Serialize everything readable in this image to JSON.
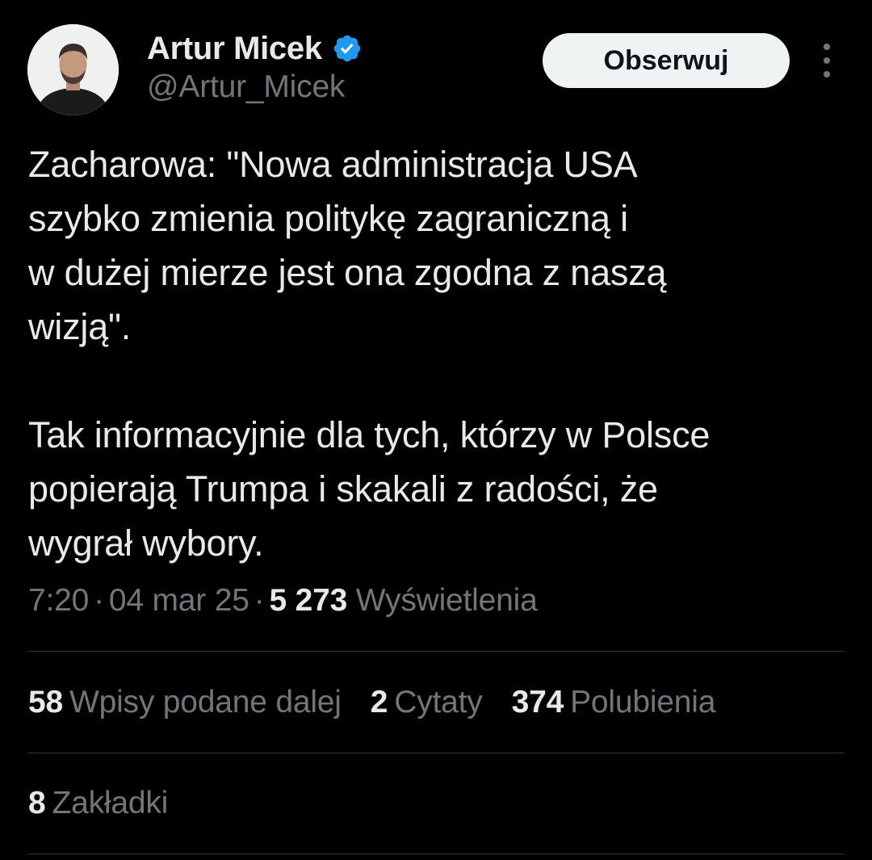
{
  "author": {
    "name": "Artur Micek",
    "handle": "@Artur_Micek",
    "verified_icon": "verified-badge-icon",
    "verified_color": "#1d9bf0"
  },
  "follow_button": {
    "label": "Obserwuj"
  },
  "more_button": {
    "icon": "more-vertical-icon"
  },
  "tweet": {
    "paragraph_1": "Zacharowa: \"Nowa administracja USA\nszybko zmienia politykę zagraniczną i\nw dużej mierze jest ona zgodna z naszą\nwizją\".",
    "paragraph_2": "Tak informacyjnie dla tych, którzy w Polsce\npopierają Trumpa i skakali z radości, że\nwygrał wybory."
  },
  "meta": {
    "time": "7:20",
    "date": "04 mar 25",
    "views_count": "5 273",
    "views_label": "Wyświetlenia"
  },
  "stats": {
    "reposts": {
      "count": "58",
      "label": "Wpisy podane dalej"
    },
    "quotes": {
      "count": "2",
      "label": "Cytaty"
    },
    "likes": {
      "count": "374",
      "label": "Polubienia"
    },
    "bookmarks": {
      "count": "8",
      "label": "Zakładki"
    }
  },
  "colors": {
    "background": "#000000",
    "text_primary": "#e7e9ea",
    "text_secondary": "#71767b",
    "divider": "#2f3336",
    "button_bg": "#eff3f4"
  }
}
